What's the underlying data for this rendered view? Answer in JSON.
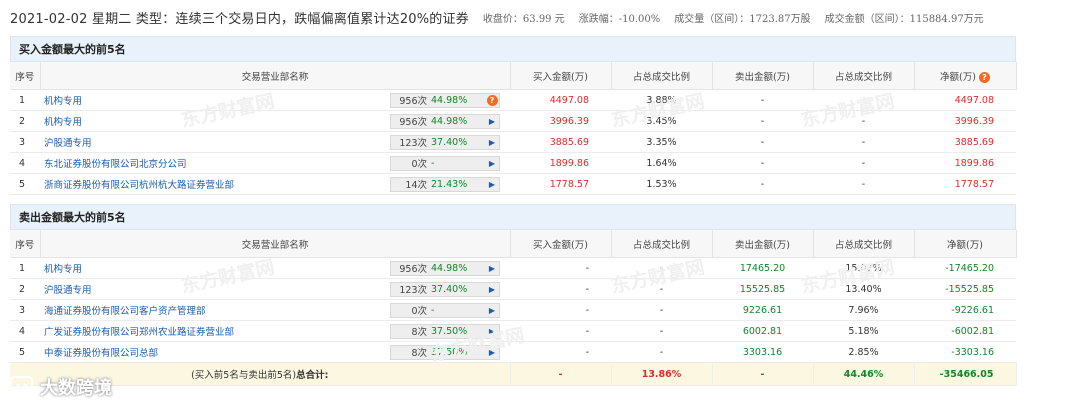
{
  "header": {
    "title": "2021-02-02 星期二  类型：连续三个交易日内，跌幅偏离值累计达20%的证券",
    "close_price": "收盘价：63.99 元",
    "change": "涨跌幅：-10.00%",
    "volume": "成交量（区间）：1723.87万股",
    "amount": "成交金额（区间）：115884.97万元"
  },
  "buy": {
    "title": "买入金额最大的前5名",
    "columns": [
      "序号",
      "交易营业部名称",
      "买入金额(万)",
      "占总成交比例",
      "卖出金额(万)",
      "占总成交比例",
      "净额(万)"
    ],
    "rows": [
      {
        "idx": "1",
        "name": "机构专用",
        "cnt": "956次",
        "pct": "44.98%",
        "buy": "4497.08",
        "buy_ratio": "3.88%",
        "sell": "-",
        "sell_ratio": "-",
        "net": "4497.08"
      },
      {
        "idx": "2",
        "name": "机构专用",
        "cnt": "956次",
        "pct": "44.98%",
        "buy": "3996.39",
        "buy_ratio": "3.45%",
        "sell": "-",
        "sell_ratio": "-",
        "net": "3996.39"
      },
      {
        "idx": "3",
        "name": "沪股通专用",
        "cnt": "123次",
        "pct": "37.40%",
        "buy": "3885.69",
        "buy_ratio": "3.35%",
        "sell": "-",
        "sell_ratio": "-",
        "net": "3885.69"
      },
      {
        "idx": "4",
        "name": "东北证券股份有限公司北京分公司",
        "cnt": "0次",
        "pct": "-",
        "buy": "1899.86",
        "buy_ratio": "1.64%",
        "sell": "-",
        "sell_ratio": "-",
        "net": "1899.86"
      },
      {
        "idx": "5",
        "name": "浙商证券股份有限公司杭州杭大路证券营业部",
        "cnt": "14次",
        "pct": "21.43%",
        "buy": "1778.57",
        "buy_ratio": "1.53%",
        "sell": "-",
        "sell_ratio": "-",
        "net": "1778.57"
      }
    ]
  },
  "sell": {
    "title": "卖出金额最大的前5名",
    "columns": [
      "序号",
      "交易营业部名称",
      "买入金额(万)",
      "占总成交比例",
      "卖出金额(万)",
      "占总成交比例",
      "净额(万)"
    ],
    "rows": [
      {
        "idx": "1",
        "name": "机构专用",
        "cnt": "956次",
        "pct": "44.98%",
        "buy": "-",
        "buy_ratio": "-",
        "sell": "17465.20",
        "sell_ratio": "15.07%",
        "net": "-17465.20"
      },
      {
        "idx": "2",
        "name": "沪股通专用",
        "cnt": "123次",
        "pct": "37.40%",
        "buy": "-",
        "buy_ratio": "-",
        "sell": "15525.85",
        "sell_ratio": "13.40%",
        "net": "-15525.85"
      },
      {
        "idx": "3",
        "name": "海通证券股份有限公司客户资产管理部",
        "cnt": "0次",
        "pct": "-",
        "buy": "-",
        "buy_ratio": "-",
        "sell": "9226.61",
        "sell_ratio": "7.96%",
        "net": "-9226.61"
      },
      {
        "idx": "4",
        "name": "广发证券股份有限公司郑州农业路证券营业部",
        "cnt": "8次",
        "pct": "37.50%",
        "buy": "-",
        "buy_ratio": "-",
        "sell": "6002.81",
        "sell_ratio": "5.18%",
        "net": "-6002.81"
      },
      {
        "idx": "5",
        "name": "中泰证券股份有限公司总部",
        "cnt": "8次",
        "pct": "37.50%",
        "buy": "-",
        "buy_ratio": "-",
        "sell": "3303.16",
        "sell_ratio": "2.85%",
        "net": "-3303.16"
      }
    ],
    "summary": {
      "label_prefix": "(买入前5名与卖出前5名)",
      "label_bold": "总合计:",
      "buy": "-",
      "buy_ratio": "13.86%",
      "sell": "-",
      "sell_ratio": "44.46%",
      "net": "-35466.05"
    }
  },
  "watermark_text": "东方财富网",
  "logo": {
    "text": "大数跨境"
  },
  "colors": {
    "up": "#e12b2b",
    "down": "#12862a",
    "link": "#1b5dae",
    "section_bg": "#e9f2fb",
    "summary_bg": "#fbf7e0",
    "help_icon": "#f26b22"
  }
}
